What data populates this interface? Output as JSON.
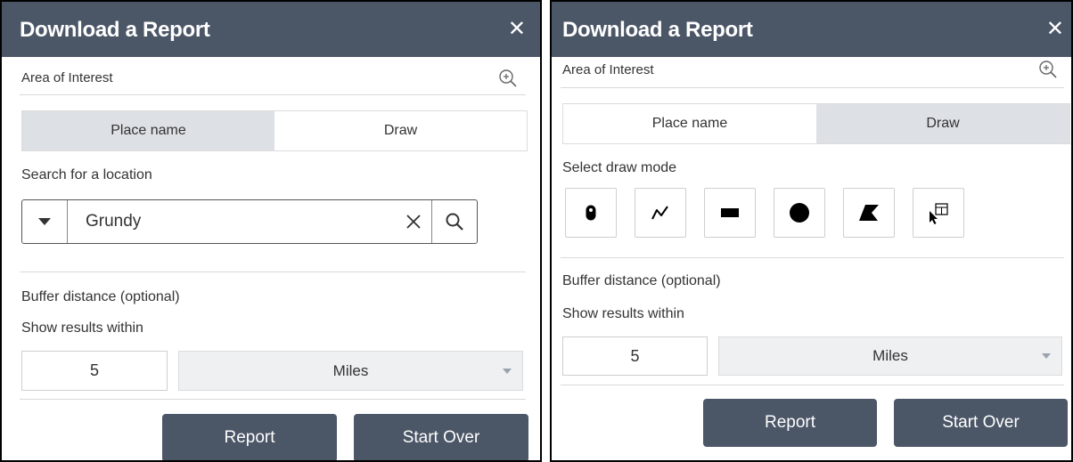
{
  "left_panel": {
    "title": "Download a Report",
    "close_glyph": "✕",
    "area_of_interest": "Area of Interest",
    "tabs": [
      {
        "label": "Place name",
        "active": true
      },
      {
        "label": "Draw",
        "active": false
      }
    ],
    "search_label": "Search for a location",
    "search_value": "Grundy",
    "buffer_label": "Buffer distance (optional)",
    "within_label": "Show results within",
    "distance_value": "5",
    "unit_value": "Miles",
    "report_button": "Report",
    "start_over_button": "Start Over"
  },
  "right_panel": {
    "title": "Download a Report",
    "close_glyph": "✕",
    "area_of_interest": "Area of Interest",
    "tabs": [
      {
        "label": "Place name",
        "active": false
      },
      {
        "label": "Draw",
        "active": true
      }
    ],
    "draw_mode_label": "Select draw mode",
    "draw_tools": [
      "point-icon",
      "polyline-icon",
      "rectangle-icon",
      "circle-icon",
      "polygon-icon",
      "select-feature-icon"
    ],
    "buffer_label": "Buffer distance (optional)",
    "within_label": "Show results within",
    "distance_value": "5",
    "unit_value": "Miles",
    "report_button": "Report",
    "start_over_button": "Start Over"
  },
  "colors": {
    "header": "#4b5667",
    "active_tab": "#dde0e4",
    "unit_bg": "#eef0f2",
    "divider": "#dadada"
  }
}
